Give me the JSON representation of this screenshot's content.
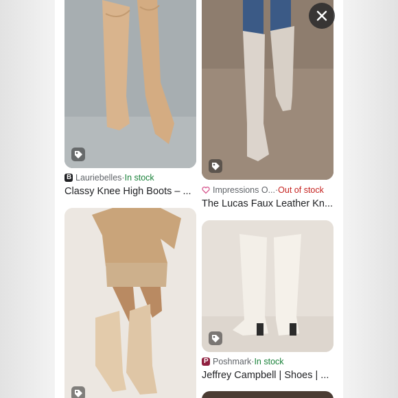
{
  "results": [
    {
      "source": "Lauriebelles",
      "separator": " · ",
      "stock": "In stock",
      "title": "Classy Knee High Boots – ...",
      "logo_icon": "lauriebelles-logo-icon",
      "stock_color": "#188038"
    },
    {
      "source": "Impressions O...",
      "separator": " · ",
      "stock": "Out of stock",
      "title": "The Lucas Faux Leather Kn...",
      "logo_icon": "heart-icon",
      "stock_color": "#c5221f"
    },
    {
      "source": "",
      "separator": "",
      "stock": "",
      "title": "",
      "logo_icon": "",
      "stock_color": ""
    },
    {
      "source": "Poshmark",
      "separator": " · ",
      "stock": "In stock",
      "title": "Jeffrey Campbell | Shoes | ...",
      "logo_icon": "poshmark-logo-icon",
      "stock_color": "#188038"
    }
  ],
  "close_button_icon": "close-icon",
  "tag_icon": "price-tag-icon"
}
